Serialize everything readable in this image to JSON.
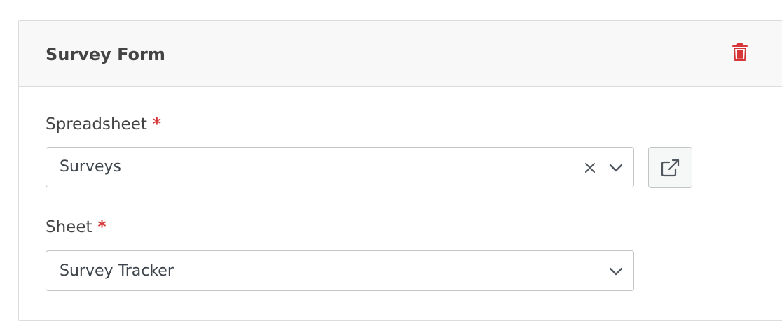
{
  "form": {
    "title": "Survey Form",
    "delete_icon": "trash-icon",
    "delete_color": "#d63638"
  },
  "spreadsheet": {
    "label": "Spreadsheet",
    "required_marker": "*",
    "value": "Surveys",
    "clear_icon": "close-icon",
    "dropdown_icon": "chevron-down-icon",
    "open_icon": "external-link-icon"
  },
  "sheet": {
    "label": "Sheet",
    "required_marker": "*",
    "value": "Survey Tracker",
    "dropdown_icon": "chevron-down-icon"
  },
  "colors": {
    "required": "#d63638",
    "header_bg": "#f8f8f8",
    "border": "#c3c4c7"
  }
}
